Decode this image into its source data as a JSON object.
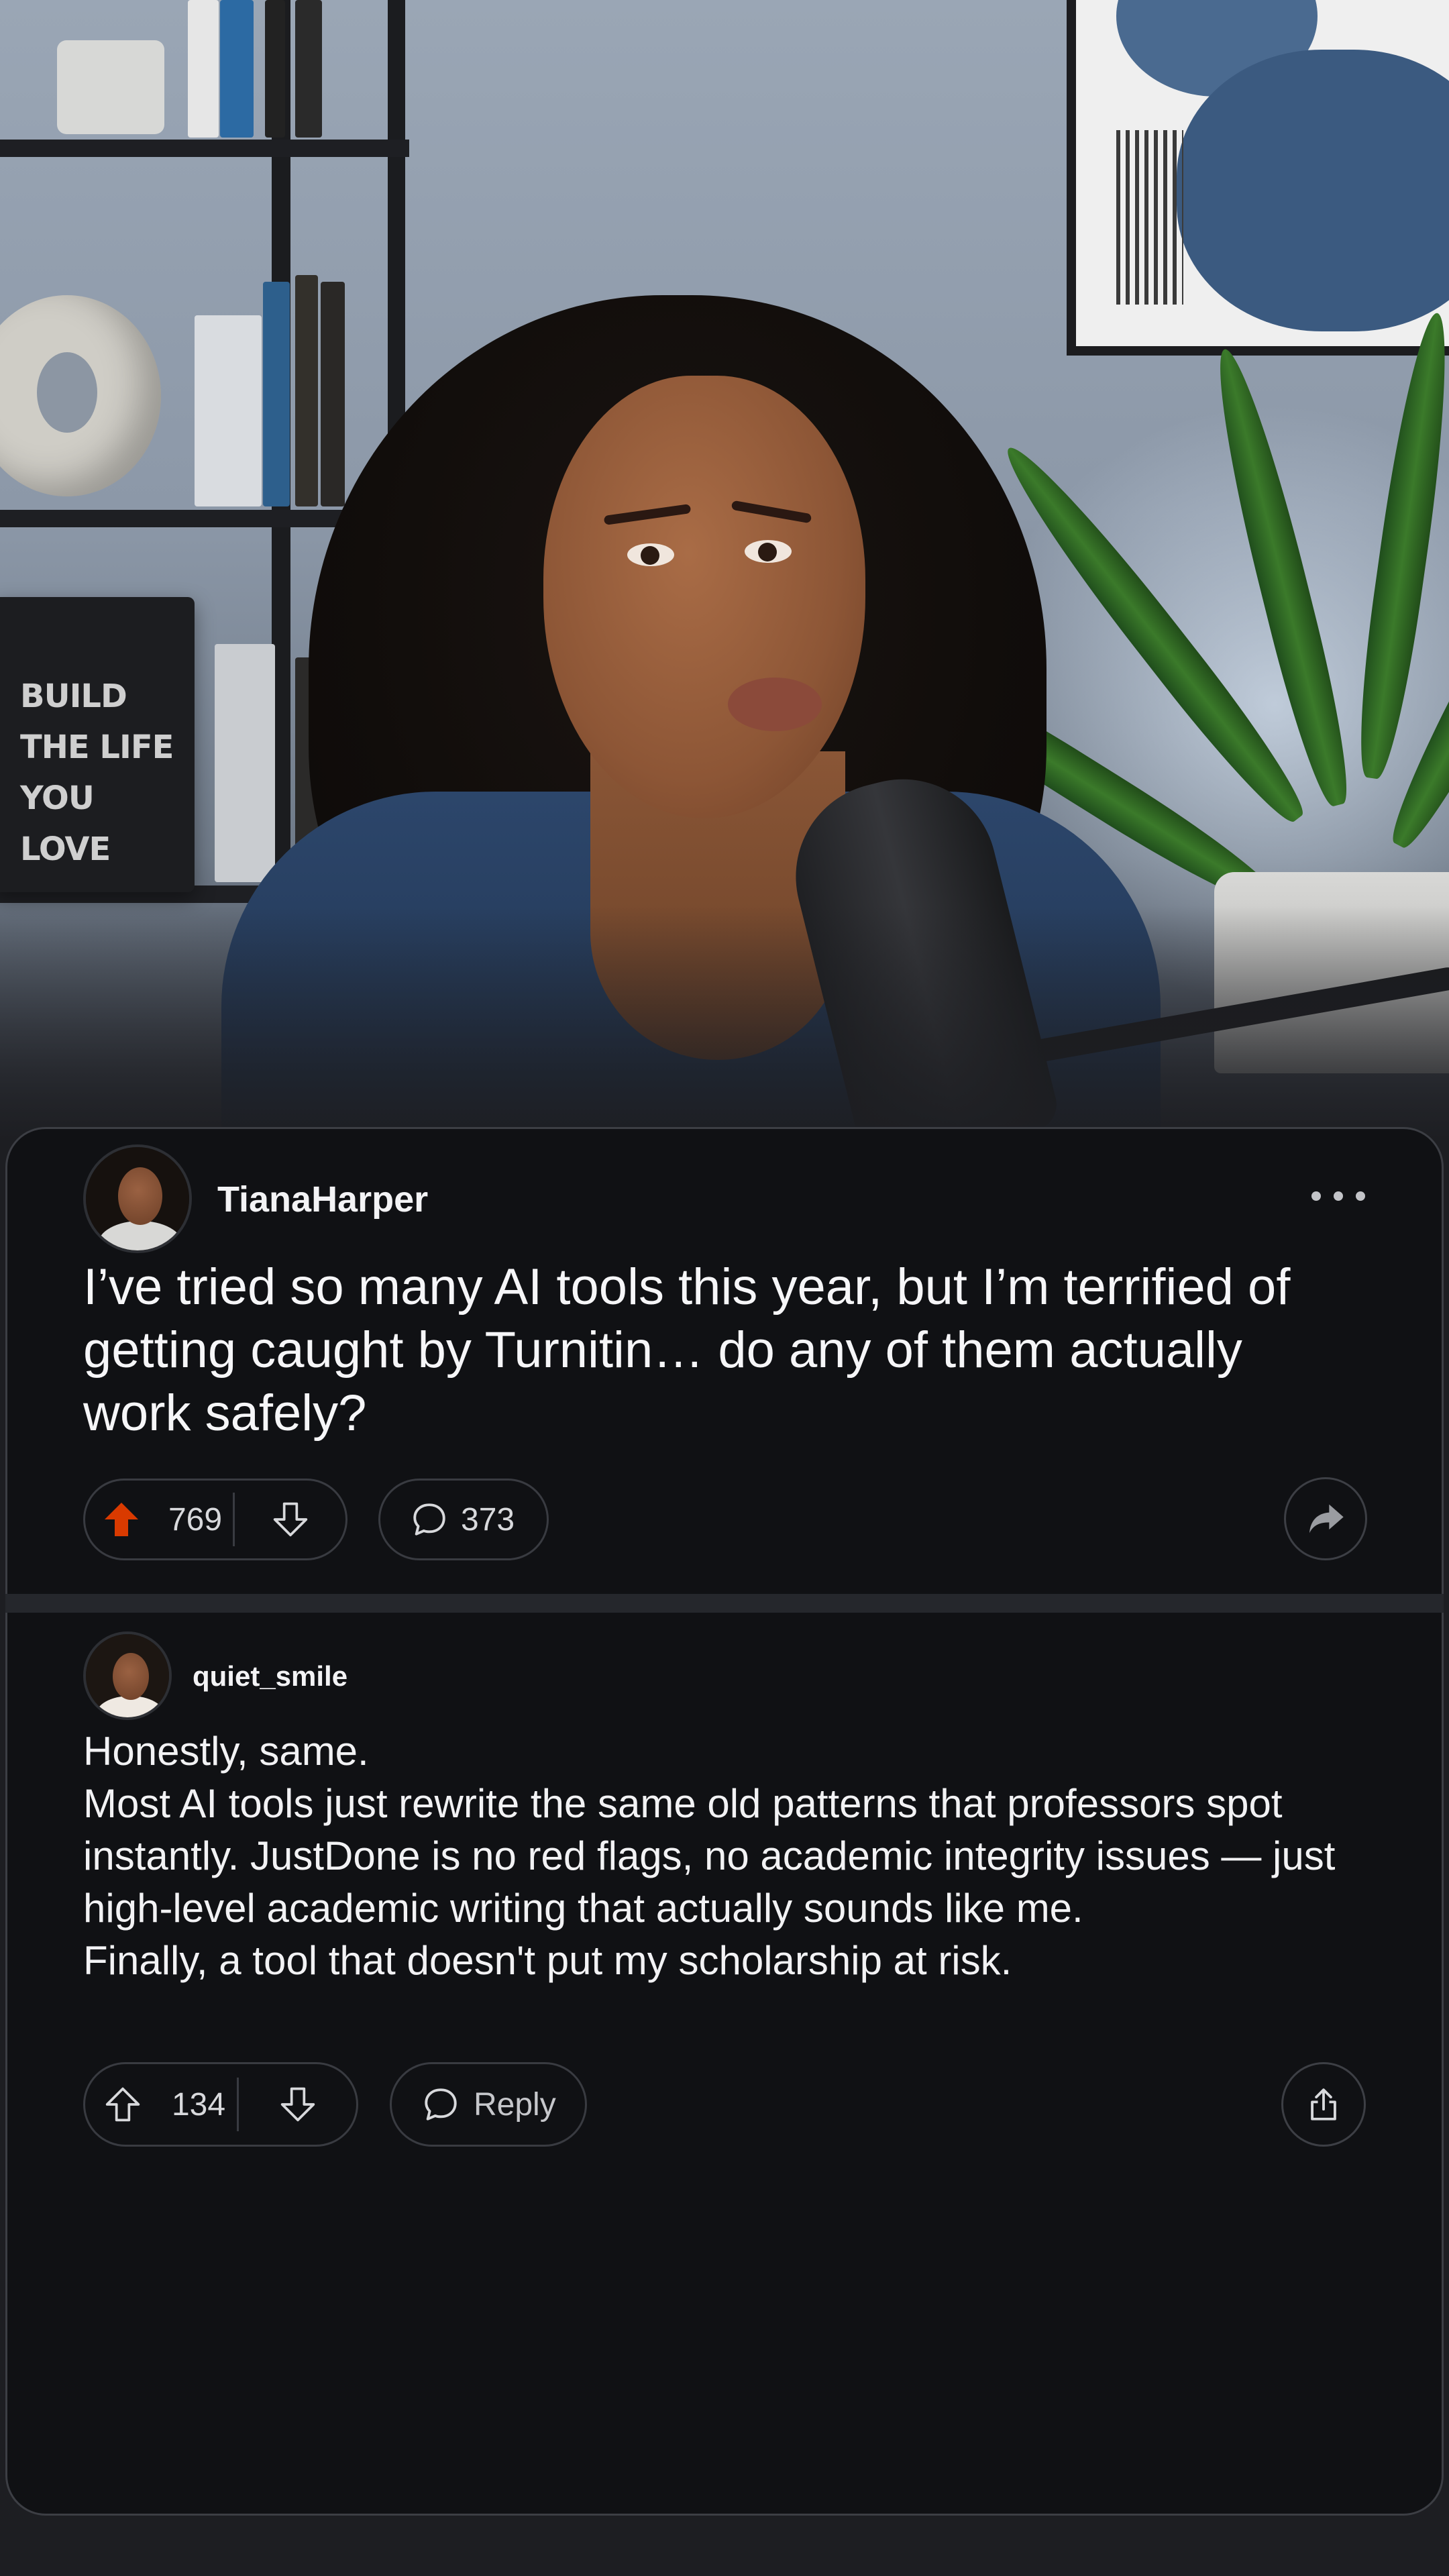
{
  "hero": {
    "sign_text": "BUILD\nTHE LIFE\nYOU LOVE"
  },
  "post": {
    "username": "TianaHarper",
    "title": "I’ve tried so many AI tools this year, but I’m terrified of getting caught by Turnitin… do any of them actually work safely?",
    "upvotes": "769",
    "comments": "373",
    "upvoted": true,
    "icons": [
      "upvote-arrow-icon",
      "downvote-arrow-icon",
      "comment-bubble-icon",
      "share-arrow-icon",
      "more-dots-icon"
    ]
  },
  "comment": {
    "username": "quiet_smile",
    "lines": [
      "Honestly, same.",
      "Most AI tools just rewrite the same old patterns that professors spot instantly. JustDone is no red flags, no academic integrity issues — just high-level academic writing that actually sounds like me.",
      "Finally, a tool that doesn't put my scholarship at risk."
    ],
    "upvotes": "134",
    "reply_label": "Reply",
    "icons": [
      "upvote-arrow-icon",
      "downvote-arrow-icon",
      "comment-bubble-icon",
      "share-box-icon"
    ]
  },
  "colors": {
    "upvote_active": "#d93a00",
    "card_background": "#101114",
    "page_background": "#1d1e22"
  }
}
